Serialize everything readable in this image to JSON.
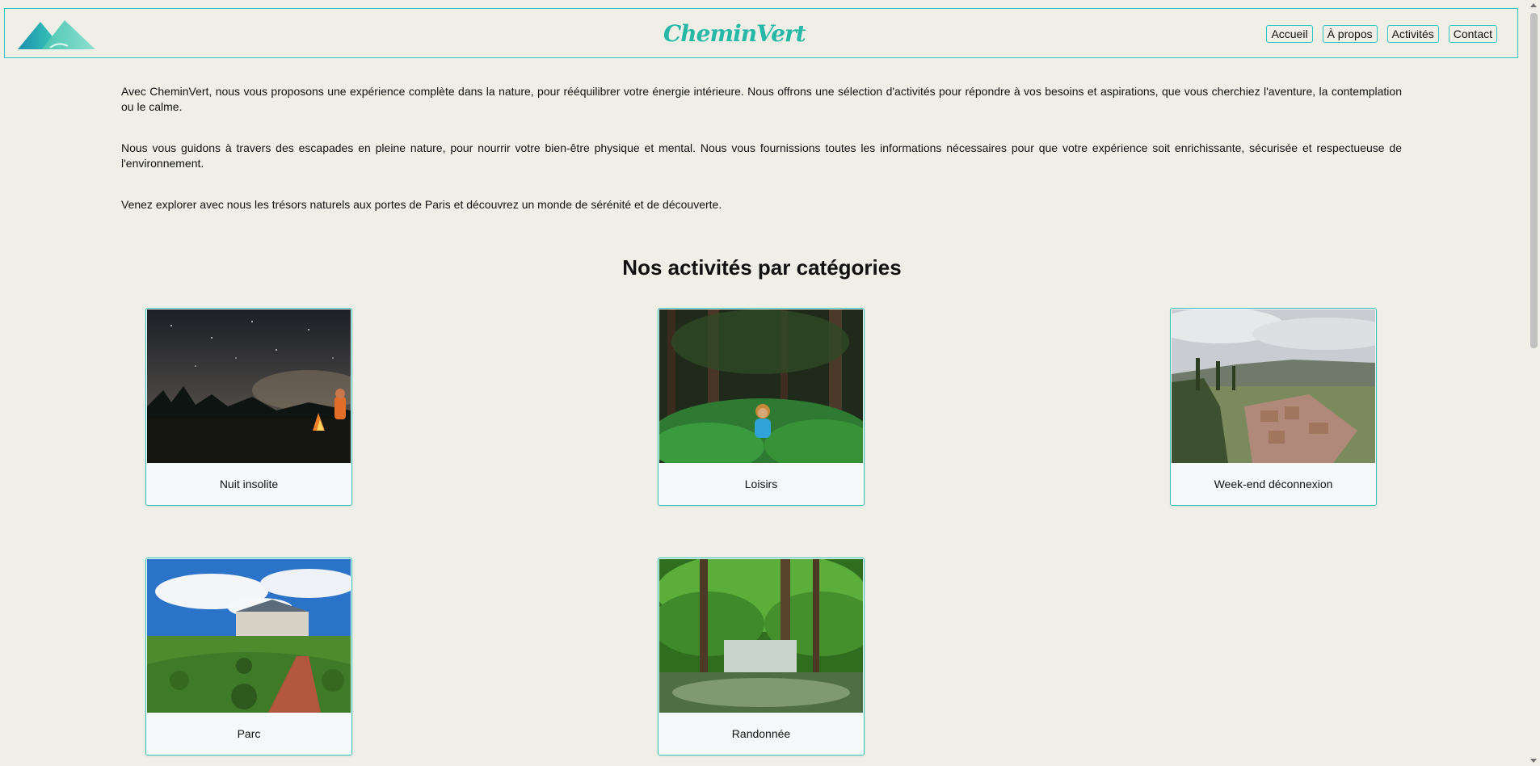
{
  "header": {
    "brand": "CheminVert",
    "nav": [
      "Accueil",
      "À propos",
      "Activités",
      "Contact"
    ]
  },
  "intro": [
    "Avec CheminVert, nous vous proposons une expérience complète dans la nature, pour rééquilibrer votre énergie intérieure. Nous offrons une sélection d'activités pour répondre à vos besoins et aspirations, que vous cherchiez l'aventure, la contemplation ou le calme.",
    "Nous vous guidons à travers des escapades en pleine nature, pour nourrir votre bien-être physique et mental. Nous vous fournissions toutes les informations nécessaires pour que votre expérience soit enrichissante, sécurisée et respectueuse de l'environnement.",
    "Venez explorer avec nous les trésors naturels aux portes de Paris et découvrez un monde de sérénité et de découverte."
  ],
  "section_title": "Nos activités par catégories",
  "categories": [
    {
      "label": "Nuit insolite",
      "icon": "campfire-night-image"
    },
    {
      "label": "Loisirs",
      "icon": "forest-meditation-image"
    },
    {
      "label": "Week-end déconnexion",
      "icon": "village-landscape-image"
    },
    {
      "label": "Parc",
      "icon": "chateau-garden-image"
    },
    {
      "label": "Randonnée",
      "icon": "forest-waterfall-image"
    }
  ],
  "colors": {
    "accent": "#2cc4bd",
    "background": "#efefe7",
    "card": "#f6f9f9"
  }
}
